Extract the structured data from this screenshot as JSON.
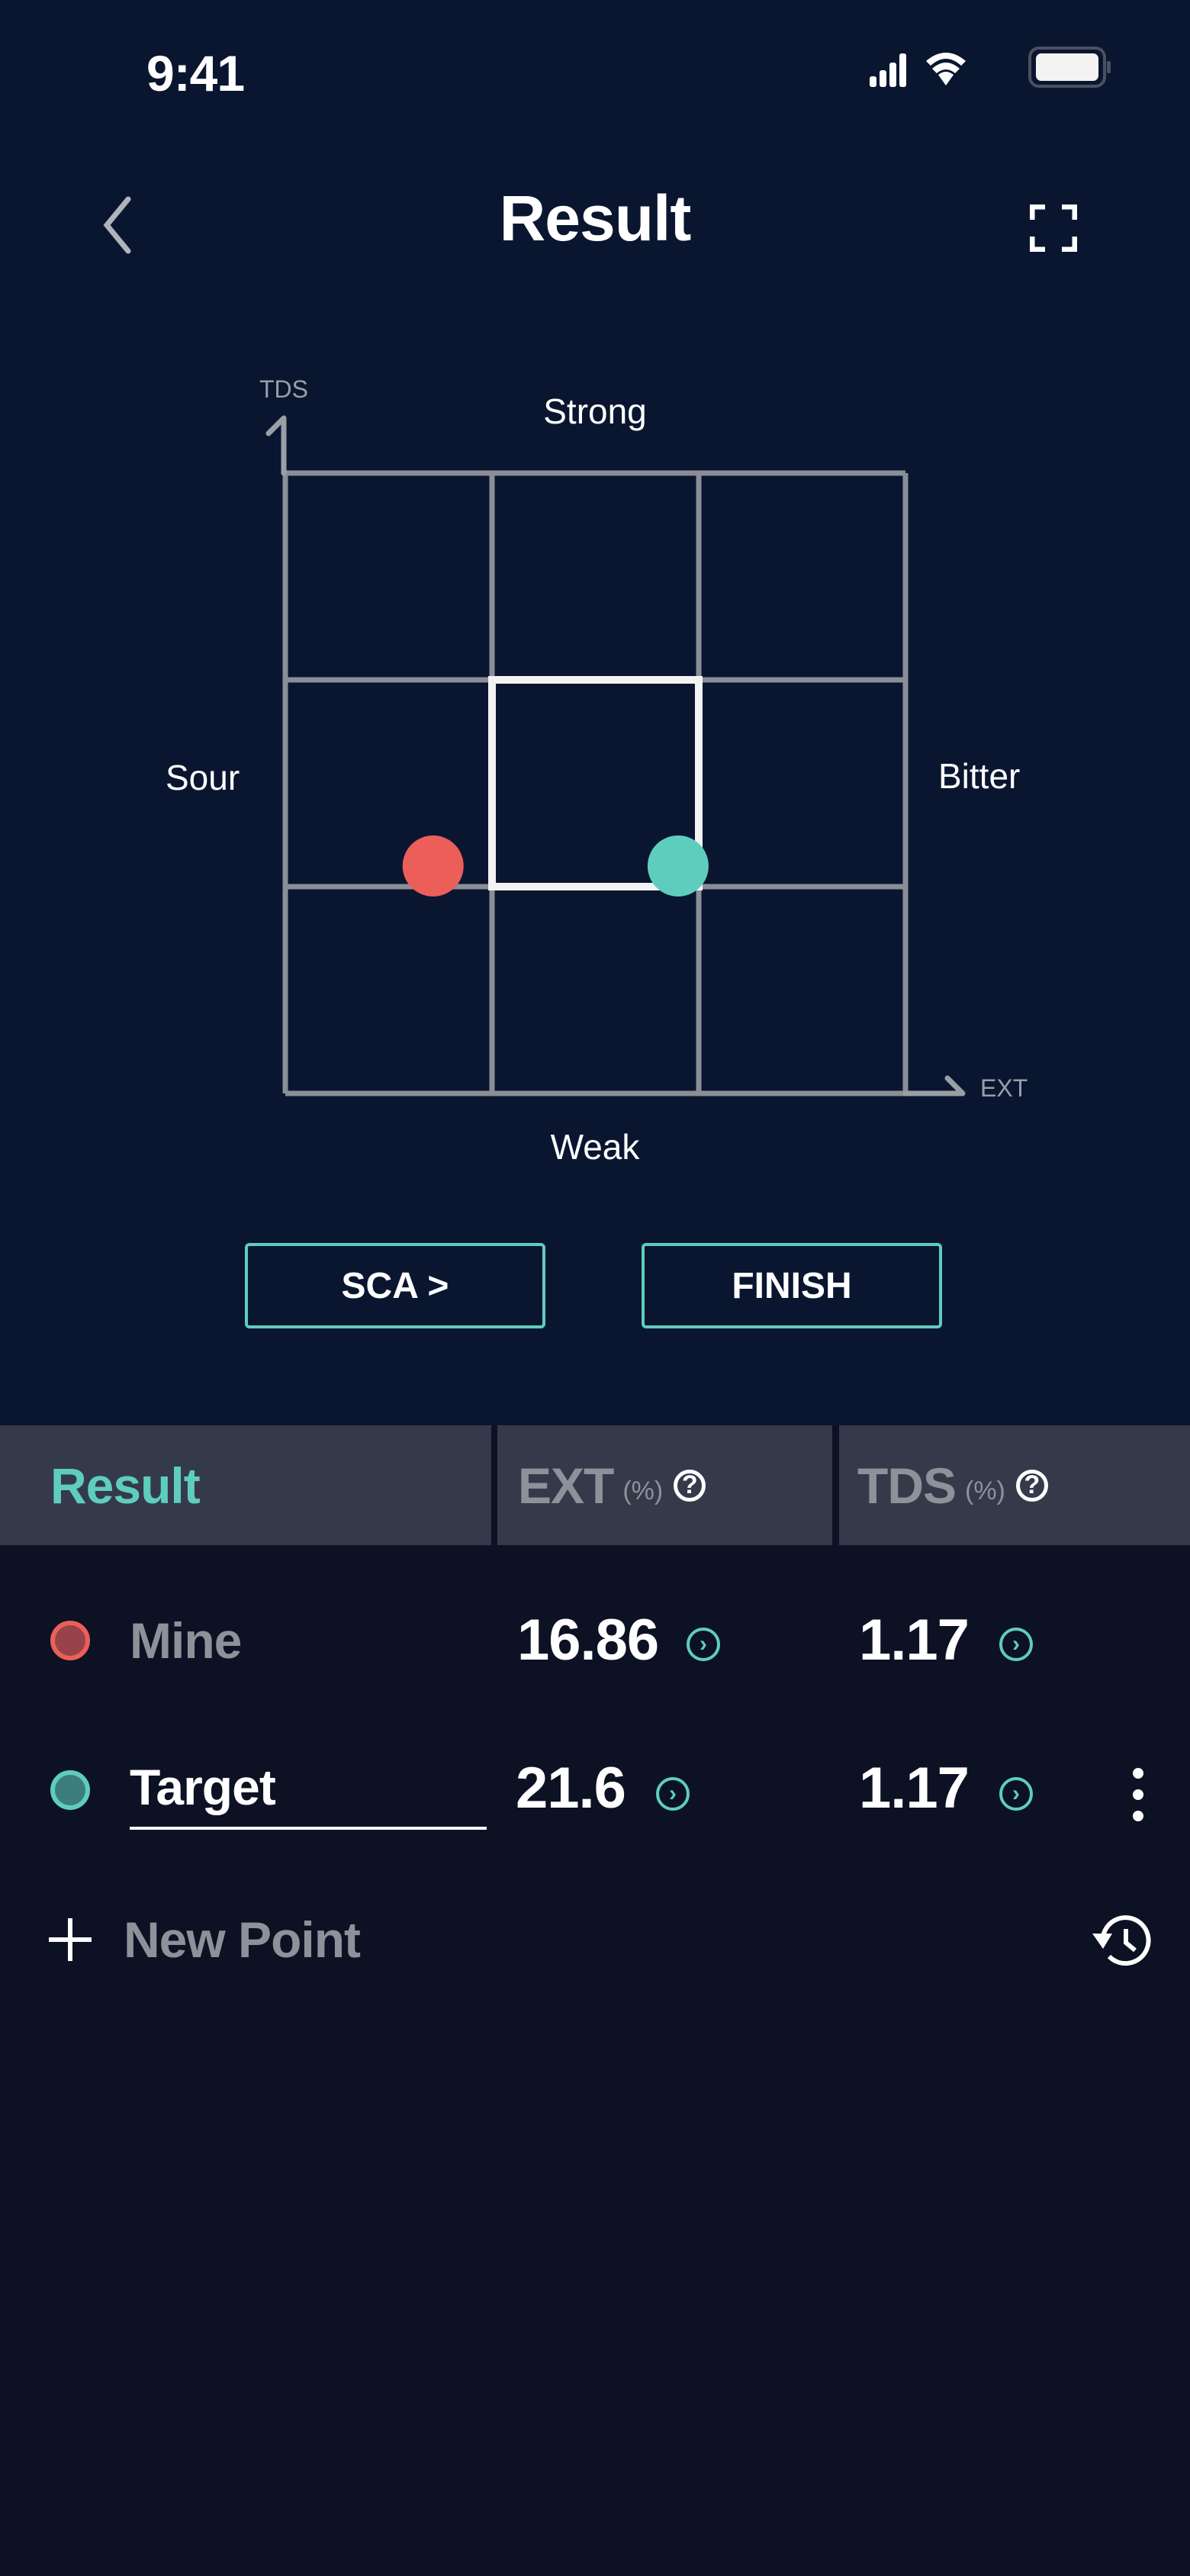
{
  "status_bar": {
    "time": "9:41",
    "icons": [
      "signal-icon",
      "wifi-icon",
      "battery-icon"
    ]
  },
  "nav": {
    "title": "Result",
    "back_icon": "chevron-left-icon",
    "fullscreen_icon": "fullscreen-icon"
  },
  "chart_data": {
    "type": "scatter",
    "xlabel": "EXT",
    "ylabel": "TDS",
    "region_labels": {
      "top": "Strong",
      "bottom": "Weak",
      "left": "Sour",
      "right": "Bitter"
    },
    "xlim": [
      14,
      26
    ],
    "ylim": [
      0.95,
      1.55
    ],
    "grid": "3x3",
    "ideal_box": {
      "x": [
        18,
        22
      ],
      "y": [
        1.15,
        1.35
      ]
    },
    "series": [
      {
        "name": "Mine",
        "x": 16.86,
        "y": 1.17,
        "color": "#ec5f59"
      },
      {
        "name": "Target",
        "x": 21.6,
        "y": 1.17,
        "color": "#5fcdbd"
      }
    ]
  },
  "buttons": {
    "sca": "SCA >",
    "finish": "FINISH"
  },
  "table": {
    "headers": {
      "result": "Result",
      "ext": "EXT",
      "ext_unit": "(%)",
      "tds": "TDS",
      "tds_unit": "(%)"
    },
    "rows": [
      {
        "label": "Mine",
        "ext": "16.86",
        "tds": "1.17",
        "color": "#ec5f59"
      },
      {
        "label": "Target",
        "ext": "21.6",
        "tds": "1.17",
        "color": "#5fcdbd"
      }
    ],
    "new_point": "New Point"
  },
  "colors": {
    "accent": "#5fcdbd",
    "mine": "#ec5f59",
    "background": "#0a1630",
    "header": "#353a4a"
  }
}
